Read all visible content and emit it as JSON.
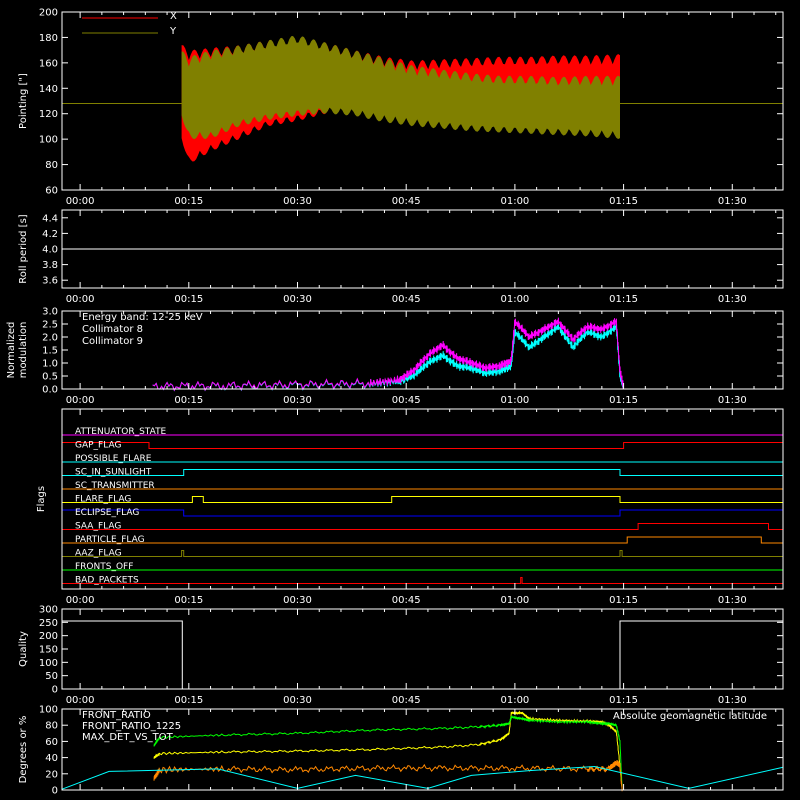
{
  "chart_data": [
    {
      "id": "pointing",
      "type": "area",
      "ylabel": "Pointing [\"]",
      "ylim": [
        60,
        200
      ],
      "yticks": [
        60,
        80,
        100,
        120,
        140,
        160,
        180,
        200
      ],
      "x_tick_labels": [
        "00:00",
        "00:15",
        "00:30",
        "00:45",
        "01:00",
        "01:15",
        "01:30"
      ],
      "xlim_minutes": [
        -2.5,
        97
      ],
      "x_ticks_minutes": [
        0,
        15,
        30,
        45,
        60,
        75,
        90
      ],
      "legend": [
        {
          "name": "X",
          "color": "#ff0000"
        },
        {
          "name": "Y",
          "color": "#808000"
        }
      ],
      "baseline": 128,
      "data_span_minutes": [
        14,
        74.5
      ],
      "series": [
        {
          "name": "X",
          "color": "#ff0000",
          "x": [
            14,
            15,
            18,
            22,
            26,
            30,
            34,
            38,
            42,
            46,
            50,
            54,
            58,
            62,
            66,
            70,
            74.5
          ],
          "upper": [
            175,
            170,
            172,
            174,
            178,
            180,
            176,
            170,
            165,
            162,
            163,
            164,
            165,
            165,
            166,
            166,
            167
          ],
          "lower": [
            100,
            80,
            90,
            100,
            110,
            114,
            120,
            124,
            126,
            128,
            129,
            130,
            130,
            130,
            130,
            130,
            130
          ]
        },
        {
          "name": "Y",
          "color": "#808000",
          "x": [
            14,
            15,
            18,
            22,
            26,
            30,
            34,
            38,
            42,
            46,
            50,
            54,
            58,
            62,
            66,
            70,
            74.5
          ],
          "upper": [
            170,
            165,
            170,
            174,
            178,
            182,
            176,
            170,
            164,
            158,
            155,
            152,
            150,
            150,
            149,
            150,
            150
          ],
          "lower": [
            118,
            100,
            100,
            110,
            115,
            118,
            120,
            118,
            113,
            110,
            108,
            106,
            105,
            104,
            103,
            102,
            100
          ]
        }
      ]
    },
    {
      "id": "roll-period",
      "type": "line",
      "ylabel": "Roll period [s]",
      "ylim": [
        3.5,
        4.5
      ],
      "yticks": [
        3.6,
        3.8,
        4.0,
        4.2,
        4.4
      ],
      "ytick_labels": [
        "3.6",
        "3.8",
        "4.0",
        "4.2",
        "4.4"
      ],
      "x_tick_labels": [
        "00:00",
        "00:15",
        "00:30",
        "00:45",
        "01:00",
        "01:15",
        "01:30"
      ],
      "series": [
        {
          "name": "",
          "color": "#ffffff",
          "x": [
            -2.5,
            97
          ],
          "y": [
            4.0,
            4.0
          ]
        }
      ]
    },
    {
      "id": "modulation",
      "type": "line",
      "ylabel": "Normalized modulation",
      "ylabel_lines": [
        "Normalized",
        "modulation"
      ],
      "ylim": [
        0,
        3.0
      ],
      "yticks": [
        0,
        0.5,
        1.0,
        1.5,
        2.0,
        2.5,
        3.0
      ],
      "ytick_labels": [
        "0.0",
        "0.5",
        "1.0",
        "1.5",
        "2.0",
        "2.5",
        "3.0"
      ],
      "x_tick_labels": [
        "00:00",
        "00:15",
        "00:30",
        "00:45",
        "01:00",
        "01:15",
        "01:30"
      ],
      "annotation": "Energy band: 12-25 keV",
      "series": [
        {
          "name": "Collimator 8",
          "color": "#00ffff",
          "x": [
            10,
            20,
            30,
            40,
            44,
            46,
            48,
            50,
            52,
            54,
            56,
            58,
            59.5,
            60,
            62,
            64,
            66,
            68,
            70,
            72,
            74,
            74.5,
            75
          ],
          "y": [
            0.1,
            0.12,
            0.15,
            0.2,
            0.3,
            0.5,
            1.0,
            1.3,
            0.9,
            0.8,
            0.6,
            0.7,
            0.9,
            2.2,
            1.6,
            2.0,
            2.4,
            1.6,
            2.2,
            2.0,
            2.4,
            0.5,
            0.05
          ]
        },
        {
          "name": "Collimator 9",
          "color": "#ff00ff",
          "x": [
            10,
            20,
            30,
            40,
            44,
            46,
            48,
            50,
            52,
            54,
            56,
            58,
            59.5,
            60,
            62,
            64,
            66,
            68,
            70,
            72,
            74,
            74.5,
            75
          ],
          "y": [
            0.1,
            0.13,
            0.17,
            0.22,
            0.35,
            0.7,
            1.3,
            1.7,
            1.2,
            1.0,
            0.8,
            0.9,
            1.1,
            2.6,
            2.0,
            2.3,
            2.6,
            1.9,
            2.4,
            2.3,
            2.6,
            0.7,
            0.05
          ]
        }
      ]
    },
    {
      "id": "flags",
      "type": "line",
      "ylabel": "Flags",
      "x_tick_labels": [
        "00:00",
        "00:15",
        "00:30",
        "00:45",
        "01:00",
        "01:15",
        "01:30"
      ],
      "flags": [
        {
          "name": "ATTENUATOR_STATE",
          "color": "#ff00ff",
          "on": []
        },
        {
          "name": "GAP_FLAG",
          "color": "#ff0000",
          "on": [
            [
              -2.5,
              9.5
            ],
            [
              75,
              97
            ]
          ]
        },
        {
          "name": "POSSIBLE_FLARE",
          "color": "#00ffff",
          "on": []
        },
        {
          "name": "SC_IN_SUNLIGHT",
          "color": "#00ffff",
          "on": [
            [
              14.3,
              74.5
            ]
          ]
        },
        {
          "name": "SC_TRANSMITTER",
          "color": "#ff8800",
          "on": []
        },
        {
          "name": "FLARE_FLAG",
          "color": "#ffff00",
          "on": [
            [
              15.5,
              17
            ],
            [
              43,
              74.5
            ]
          ]
        },
        {
          "name": "ECLIPSE_FLAG",
          "color": "#0000ff",
          "on": [
            [
              -2.5,
              14.3
            ],
            [
              74.5,
              97
            ]
          ]
        },
        {
          "name": "SAA_FLAG",
          "color": "#ff0000",
          "on": [
            [
              77,
              95
            ]
          ]
        },
        {
          "name": "PARTICLE_FLAG",
          "color": "#ff8800",
          "on": [
            [
              75.5,
              94
            ]
          ]
        },
        {
          "name": "AAZ_FLAG",
          "color": "#808000",
          "on": [
            [
              14,
              14.3
            ],
            [
              74.5,
              74.8
            ]
          ]
        },
        {
          "name": "FRONTS_OFF",
          "color": "#00ff00",
          "on": []
        },
        {
          "name": "BAD_PACKETS",
          "color": "#ff0000",
          "on": [
            [
              60.8,
              61
            ]
          ]
        }
      ]
    },
    {
      "id": "quality",
      "type": "line",
      "ylabel": "Quality",
      "ylim": [
        0,
        300
      ],
      "yticks": [
        0,
        50,
        100,
        150,
        200,
        250,
        300
      ],
      "x_tick_labels": [
        "00:00",
        "00:15",
        "00:30",
        "00:45",
        "01:00",
        "01:15",
        "01:30"
      ],
      "series": [
        {
          "name": "",
          "color": "#ffffff",
          "x": [
            -2.5,
            14.1,
            14.1,
            74.5,
            74.5,
            97
          ],
          "y": [
            255,
            255,
            0,
            0,
            255,
            255
          ]
        }
      ]
    },
    {
      "id": "ratios",
      "type": "line",
      "ylabel": "Degrees or %",
      "ylim": [
        0,
        100
      ],
      "yticks": [
        0,
        20,
        40,
        60,
        80,
        100
      ],
      "series": [
        {
          "name": "FRONT_RATIO",
          "color": "#ffff00",
          "x": [
            10.2,
            11,
            20,
            30,
            40,
            50,
            55,
            58,
            59.2,
            59.5,
            61,
            62,
            66,
            70,
            72,
            73,
            74,
            74.5,
            74.8
          ],
          "y": [
            40,
            45,
            47,
            48,
            50,
            53,
            56,
            62,
            70,
            95,
            95,
            88,
            86,
            85,
            84,
            80,
            72,
            30,
            0
          ]
        },
        {
          "name": "FRONT_RATIO_1225",
          "color": "#00ff00",
          "x": [
            10.2,
            11,
            20,
            30,
            40,
            50,
            55,
            58,
            59.2,
            59.5,
            61,
            62,
            66,
            70,
            72,
            73,
            74,
            74.5,
            74.8
          ],
          "y": [
            55,
            65,
            68,
            70,
            74,
            76,
            78,
            80,
            82,
            90,
            88,
            86,
            84,
            84,
            82,
            82,
            80,
            60,
            0
          ]
        },
        {
          "name": "MAX_DET_VS_TOT",
          "color": "#ff8800",
          "x": [
            10.2,
            11,
            20,
            30,
            40,
            50,
            60,
            70,
            73,
            74,
            74.5,
            74.8
          ],
          "y": [
            15,
            25,
            26,
            25,
            27,
            27,
            27,
            26,
            26,
            34,
            30,
            0
          ]
        },
        {
          "name": "Absolute geomagnetic latitude",
          "color": "#00ffff",
          "x": [
            -2.5,
            4,
            19,
            30,
            38,
            48,
            54,
            62,
            71,
            84,
            97
          ],
          "y": [
            1,
            23,
            26,
            2,
            18,
            2,
            18,
            24,
            29,
            2,
            28
          ]
        }
      ]
    }
  ]
}
